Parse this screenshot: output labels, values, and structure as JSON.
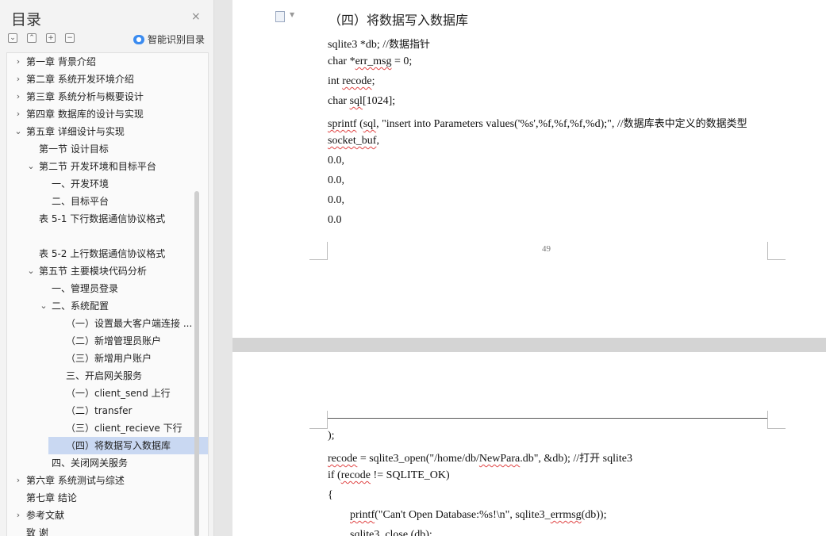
{
  "sidebar": {
    "title": "目录",
    "close_glyph": "×",
    "tools": [
      {
        "name": "collapse-all",
        "glyph": "⌄"
      },
      {
        "name": "expand-all",
        "glyph": "⌃"
      },
      {
        "name": "add",
        "glyph": "+"
      },
      {
        "name": "remove",
        "glyph": "−"
      }
    ],
    "smart_label": "智能识别目录",
    "toc": [
      {
        "text": "第一章  背景介绍",
        "level": 0,
        "chev": "›"
      },
      {
        "text": "第二章  系统开发环境介绍",
        "level": 0,
        "chev": "›"
      },
      {
        "text": "第三章  系统分析与概要设计",
        "level": 0,
        "chev": "›"
      },
      {
        "text": "第四章  数据库的设计与实现",
        "level": 0,
        "chev": "›"
      },
      {
        "text": "第五章  详细设计与实现",
        "level": 0,
        "chev": "⌄"
      },
      {
        "text": "第一节  设计目标",
        "level": 1,
        "chev": ""
      },
      {
        "text": "第二节  开发环境和目标平台",
        "level": 1,
        "chev": "⌄"
      },
      {
        "text": "一、开发环境",
        "level": 2,
        "chev": ""
      },
      {
        "text": "二、目标平台",
        "level": 2,
        "chev": ""
      },
      {
        "text": "表 5-1  下行数据通信协议格式",
        "level": 1,
        "chev": ""
      },
      {
        "text": "",
        "level": 1,
        "chev": ""
      },
      {
        "text": "表 5-2  上行数据通信协议格式",
        "level": 1,
        "chev": ""
      },
      {
        "text": "第五节  主要模块代码分析",
        "level": 1,
        "chev": "⌄"
      },
      {
        "text": "一、管理员登录",
        "level": 2,
        "chev": ""
      },
      {
        "text": "二、系统配置",
        "level": 2,
        "chev": "⌄"
      },
      {
        "text": "（一）设置最大客户端连接 ...",
        "level": 3,
        "chev": ""
      },
      {
        "text": "（二）新增管理员账户",
        "level": 3,
        "chev": ""
      },
      {
        "text": "（三）新增用户账户",
        "level": 3,
        "chev": ""
      },
      {
        "text": "三、开启网关服务",
        "level": 3,
        "chev": ""
      },
      {
        "text": "（一）client_send 上行",
        "level": 3,
        "chev": ""
      },
      {
        "text": "（二）transfer",
        "level": 3,
        "chev": ""
      },
      {
        "text": "（三）client_recieve 下行",
        "level": 3,
        "chev": ""
      },
      {
        "text": "（四）将数据写入数据库",
        "level": 3,
        "chev": "",
        "selected": true
      },
      {
        "text": "四、关闭网关服务",
        "level": 2,
        "chev": ""
      },
      {
        "text": "第六章  系统测试与综述",
        "level": 0,
        "chev": "›"
      },
      {
        "text": "第七章  结论",
        "level": 0,
        "chev": ""
      },
      {
        "text": "参考文献",
        "level": 0,
        "chev": "›"
      },
      {
        "text": "致     谢",
        "level": 0,
        "chev": ""
      }
    ]
  },
  "doc": {
    "page1": {
      "heading": "（四）将数据写入数据库",
      "page_number": "49",
      "lines": [
        [
          {
            "t": "sqlite3 *db; //"
          },
          {
            "t": "数据指针",
            "cn": true
          }
        ],
        [
          {
            "t": "char *"
          },
          {
            "t": "err_msg",
            "sq": true
          },
          {
            "t": " = 0;"
          }
        ],
        [
          {
            "t": "int "
          },
          {
            "t": "recode",
            "sq": true
          },
          {
            "t": ";"
          }
        ],
        [
          {
            "t": "char "
          },
          {
            "t": "sql",
            "sq": true
          },
          {
            "t": "[1024];"
          }
        ],
        [
          {
            "t": "sprintf",
            "sq": true
          },
          {
            "t": " ("
          },
          {
            "t": "sql",
            "sq": true
          },
          {
            "t": ", \"insert into Parameters values('%s',%f,%f,%f,%d);\", //"
          },
          {
            "t": "数据库表中定义的数据类型",
            "cn": true
          }
        ],
        [
          {
            "t": "socket_buf",
            "sq": true
          },
          {
            "t": ","
          }
        ],
        [
          {
            "t": "0.0,"
          }
        ],
        [
          {
            "t": "0.0,"
          }
        ],
        [
          {
            "t": "0.0,"
          }
        ],
        [
          {
            "t": "0.0"
          }
        ]
      ]
    },
    "page2": {
      "lines": [
        [
          {
            "t": ");"
          }
        ],
        [
          {
            "t": "recode",
            "sq": true
          },
          {
            "t": " = sqlite3_open(\"/home/db/"
          },
          {
            "t": "NewPara",
            "sq": true
          },
          {
            "t": ".db\", &db); //"
          },
          {
            "t": "打开",
            "cn": true
          },
          {
            "t": " sqlite3"
          }
        ],
        [
          {
            "t": "if ("
          },
          {
            "t": "recode",
            "sq": true
          },
          {
            "t": " != SQLITE_OK)"
          }
        ],
        [
          {
            "t": "{"
          }
        ],
        [
          {
            "t": "printf",
            "sq": true,
            "indent": true
          },
          {
            "t": "(\"Can't Open Database:%s!\\n\", sqlite3_"
          },
          {
            "t": "errmsg",
            "sq": true
          },
          {
            "t": "(db));"
          }
        ],
        [
          {
            "t": "sqlite3_close (db);",
            "indent": true
          }
        ]
      ]
    }
  }
}
